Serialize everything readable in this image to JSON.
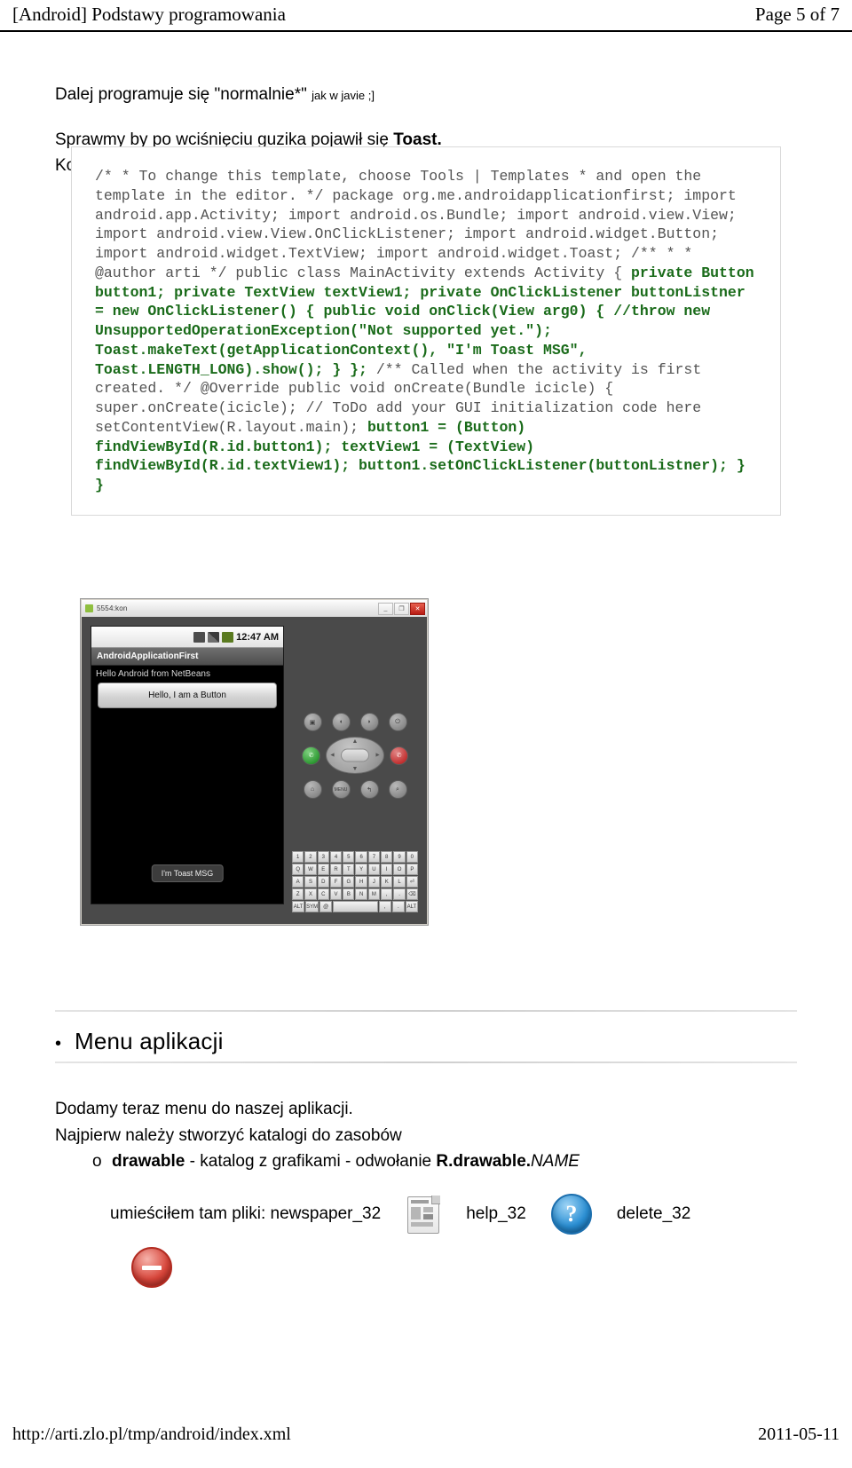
{
  "header": {
    "left": "[Android] Podstawy programowania",
    "right": "Page 5 of 7"
  },
  "footer": {
    "url": "http://arti.zlo.pl/tmp/android/index.xml",
    "date": "2011-05-11"
  },
  "intro": {
    "line1_main": "Dalej programuje się \"normalnie*\"",
    "line1_small": "jak w javie ;]",
    "line2_pre": "Sprawmy by po wciśnięciu guzika pojawił się ",
    "line2_bold": "Toast.",
    "line3": "Kod po przeróbkach będzie wyglądał następująco:"
  },
  "code": {
    "plain_1": "/* * To change this template, choose Tools | Templates * and open the template in the editor. */ package org.me.androidapplicationfirst; import android.app.Activity; import android.os.Bundle; import android.view.View; import android.view.View.OnClickListener; import android.widget.Button; import android.widget.TextView; import android.widget.Toast; /** * * @author arti */ public class MainActivity extends Activity { ",
    "green_1": "private Button button1; private TextView textView1; private OnClickListener buttonListner = new OnClickListener() { public void onClick(View arg0) { //throw new UnsupportedOperationException(\"Not supported yet.\"); Toast.makeText(getApplicationContext(), \"I'm Toast MSG\", Toast.LENGTH_LONG).show(); } }; ",
    "plain_2": "/** Called when the activity is first created. */ @Override public void onCreate(Bundle icicle) { super.onCreate(icicle); // ToDo add your GUI initialization code here setContentView(R.layout.main); ",
    "green_2": "button1 = (Button) findViewById(R.id.button1); textView1 = (TextView) findViewById(R.id.textView1); button1.setOnClickListener(buttonListner); } }",
    "green_color": "#1a6b1a",
    "plain_color": "#545454"
  },
  "emulator": {
    "window_title": "5554:kon",
    "win_minimize": "_",
    "win_restore": "❐",
    "win_close": "✕",
    "status_time": "12:47 AM",
    "status_icons": [
      "network-icon",
      "signal-icon",
      "battery-icon"
    ],
    "app_title": "AndroidApplicationFirst",
    "hello_text": "Hello Android from NetBeans",
    "button_label": "Hello, I am a Button",
    "toast_text": "I'm Toast MSG",
    "keypad": {
      "row1": [
        "camera-icon",
        "volume-down-icon",
        "volume-up-icon",
        "power-icon"
      ],
      "call": "call-icon",
      "endcall": "end-call-icon",
      "dpad_arrows": [
        "▲",
        "◄",
        "►",
        "▼"
      ],
      "row3": [
        "home-icon",
        "menu-icon",
        "back-icon",
        "search-icon"
      ],
      "row3_labels": [
        "⌂",
        "MENU",
        "↰",
        "⌕"
      ],
      "call_glyph": "✆",
      "end_glyph": "✆",
      "row1_glyphs": [
        "▣",
        "◖",
        "◗",
        "⏻"
      ]
    },
    "keyboard_rows": [
      [
        "1",
        "2",
        "3",
        "4",
        "5",
        "6",
        "7",
        "8",
        "9",
        "0"
      ],
      [
        "Q",
        "W",
        "E",
        "R",
        "T",
        "Y",
        "U",
        "I",
        "O",
        "P"
      ],
      [
        "A",
        "S",
        "D",
        "F",
        "G",
        "H",
        "J",
        "K",
        "L",
        "⏎"
      ],
      [
        "Z",
        "X",
        "C",
        "V",
        "B",
        "N",
        "M",
        ",",
        ".",
        "⌫"
      ],
      [
        "ALT",
        "SYM",
        "@",
        "",
        "",
        "",
        ",",
        ".",
        "ALT"
      ]
    ]
  },
  "section": {
    "bullet": "•",
    "title": "Menu aplikacji"
  },
  "tail": {
    "line1": "Dodamy teraz menu do naszej aplikacji.",
    "line2": "Najpierw należy stworzyć katalogi do zasobów",
    "sub_marker": "o",
    "sub_bold": "drawable",
    "sub_mid": " - katalog z grafikami - odwołanie ",
    "sub_bold2": "R.drawable.",
    "sub_italic": "NAME"
  },
  "files": {
    "lead": "umieściłem tam pliki: newspaper_32",
    "help_label": "help_32",
    "delete_label": "delete_32",
    "newspaper_icon": "newspaper-icon",
    "help_icon": "help-icon",
    "delete_icon": "delete-icon",
    "help_glyph": "?"
  }
}
